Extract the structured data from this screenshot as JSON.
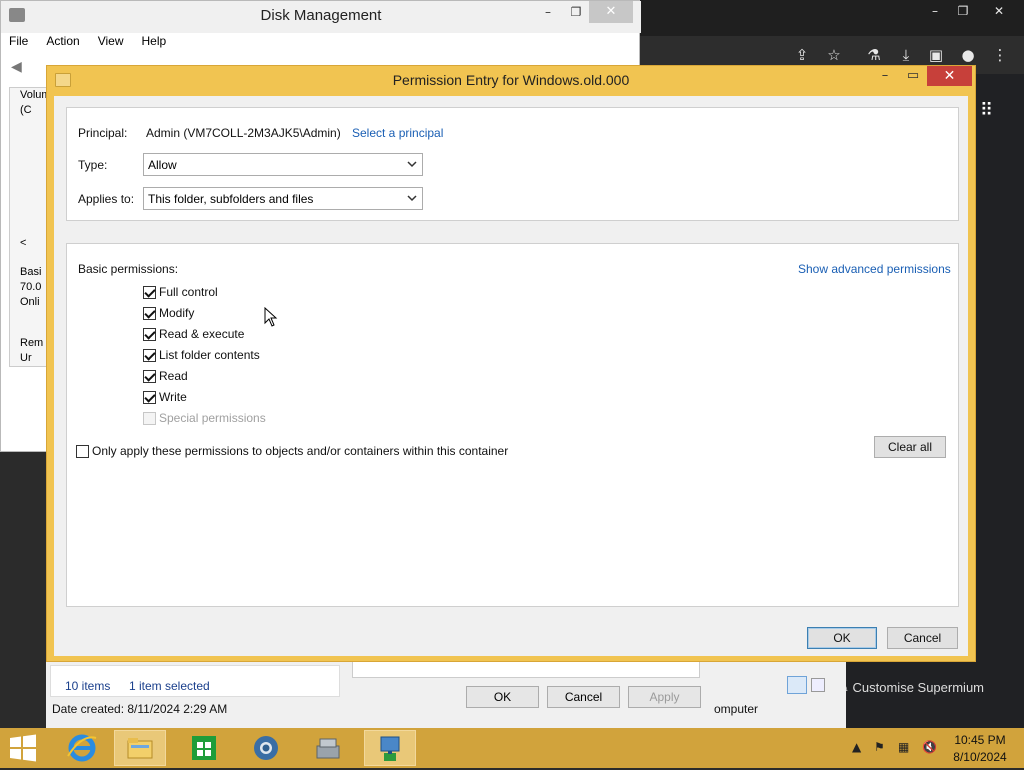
{
  "chrome": {
    "window_controls": {
      "minimize": "–",
      "maximize": "❐",
      "close": "✕"
    },
    "toolbar_icons": [
      "share-icon",
      "star-icon",
      "labs-icon",
      "download-icon",
      "sidepanel-icon",
      "profile-icon",
      "kebab-menu-icon"
    ],
    "customise_label": "Customise Supermium"
  },
  "disk_management": {
    "title": "Disk Management",
    "menu": [
      "File",
      "Action",
      "View",
      "Help"
    ],
    "column_header": "Volum",
    "row1": "(C",
    "disk_panel": {
      "line1": "Basi",
      "line2": "70.0",
      "line3": "Onli",
      "line4": "Rem",
      "line5": "Ur"
    }
  },
  "properties_dialog": {
    "status_items": "10 items",
    "status_selected": "1 item selected",
    "date_created": "Date created: 8/11/2024 2:29 AM",
    "ok_label": "OK",
    "cancel_label": "Cancel",
    "apply_label": "Apply",
    "computer_label": "omputer"
  },
  "permission_entry": {
    "title": "Permission Entry for Windows.old.000",
    "principal_label": "Principal:",
    "principal_value": "Admin (VM7COLL-2M3AJK5\\Admin)",
    "select_principal_link": "Select a principal",
    "type_label": "Type:",
    "type_value": "Allow",
    "applies_to_label": "Applies to:",
    "applies_to_value": "This folder, subfolders and files",
    "basic_permissions_label": "Basic permissions:",
    "show_advanced_link": "Show advanced permissions",
    "permissions": [
      {
        "label": "Full control",
        "checked": true,
        "disabled": false
      },
      {
        "label": "Modify",
        "checked": true,
        "disabled": false
      },
      {
        "label": "Read & execute",
        "checked": true,
        "disabled": false
      },
      {
        "label": "List folder contents",
        "checked": true,
        "disabled": false
      },
      {
        "label": "Read",
        "checked": true,
        "disabled": false
      },
      {
        "label": "Write",
        "checked": true,
        "disabled": false
      },
      {
        "label": "Special permissions",
        "checked": false,
        "disabled": true
      }
    ],
    "only_apply_label": "Only apply these permissions to objects and/or containers within this container",
    "only_apply_checked": false,
    "clear_all_label": "Clear all",
    "ok_label": "OK",
    "cancel_label": "Cancel"
  },
  "taskbar": {
    "apps": [
      "internet-explorer-icon",
      "file-explorer-icon",
      "store-icon",
      "chrome-like-icon",
      "tools-icon",
      "network-setup-icon"
    ],
    "time": "10:45 PM",
    "date": "8/10/2024"
  },
  "colors": {
    "dialog_frame": "#f1c451",
    "taskbar": "#d1a33c",
    "link": "#1a5fb4",
    "close_button": "#c7403a"
  }
}
